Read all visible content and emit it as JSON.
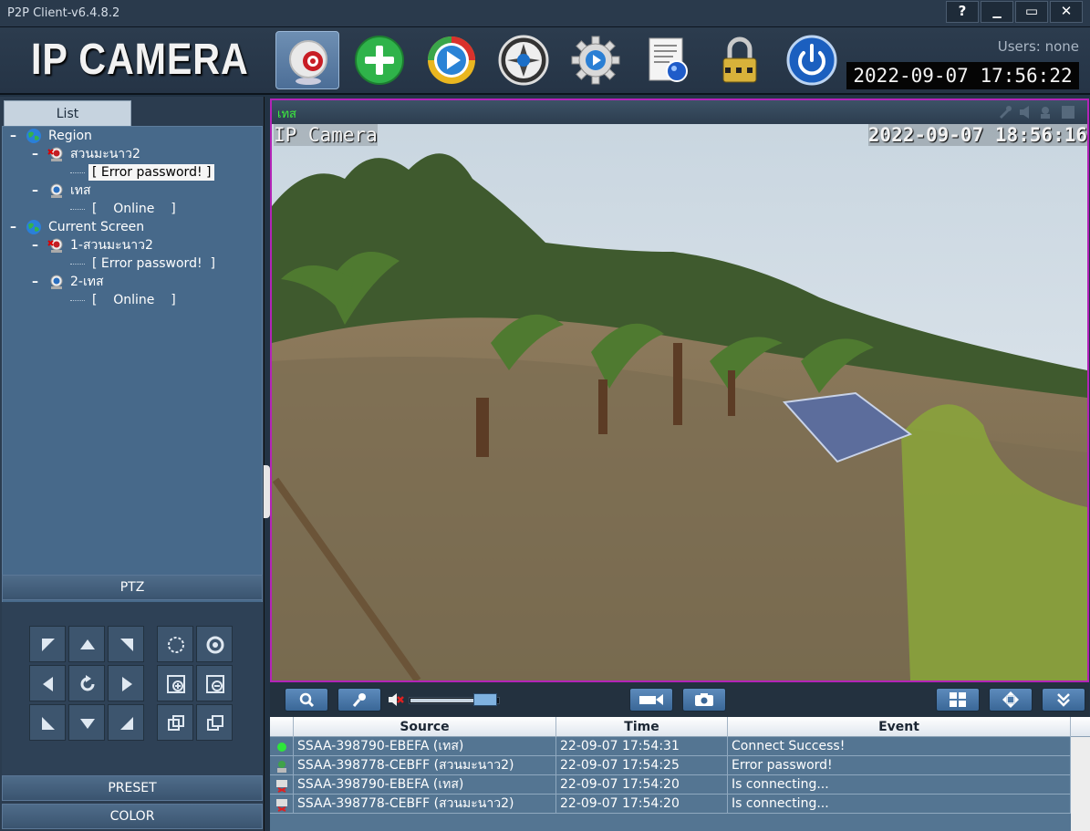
{
  "window": {
    "title": "P2P Client-v6.4.8.2",
    "controls": {
      "help": "?",
      "minimize": "▁",
      "maximize": "▭",
      "close": "✕"
    }
  },
  "header": {
    "logo": "IP CAMERA",
    "users_label": "Users: none",
    "clock": "2022-09-07  17:56:22",
    "toolbar": [
      {
        "name": "live-view",
        "icon": "webcam-icon",
        "active": true
      },
      {
        "name": "add-device",
        "icon": "plus-icon"
      },
      {
        "name": "playback",
        "icon": "play-icon"
      },
      {
        "name": "record",
        "icon": "reel-icon"
      },
      {
        "name": "settings",
        "icon": "gear-icon"
      },
      {
        "name": "log-report",
        "icon": "report-icon"
      },
      {
        "name": "lock",
        "icon": "lock-icon"
      },
      {
        "name": "power",
        "icon": "power-icon"
      }
    ]
  },
  "left": {
    "list_tab": "List",
    "tree": {
      "region": "Region",
      "region_cam1": "สวนมะนาว2",
      "region_cam1_status": "[ Error password! ]",
      "region_cam2": "เทส",
      "region_cam2_status": "[    Online    ]",
      "current": "Current Screen",
      "current_cam1": "1-สวนมะนาว2",
      "current_cam1_status": "[ Error password!  ]",
      "current_cam2": "2-เทส",
      "current_cam2_status": "[    Online    ]"
    },
    "ptz_label": "PTZ",
    "preset_label": "PRESET",
    "color_label": "COLOR"
  },
  "video": {
    "channel_name": "เทส",
    "osd_name": "IP Camera",
    "osd_time": "2022-09-07 18:56:16"
  },
  "tools": {
    "volume_level": 0.75
  },
  "log": {
    "headers": {
      "source": "Source",
      "time": "Time",
      "event": "Event"
    },
    "rows": [
      {
        "status": "success",
        "source": "SSAA-398790-EBEFA (เทส)",
        "time": "22-09-07 17:54:31",
        "event": "Connect Success!"
      },
      {
        "status": "error",
        "source": "SSAA-398778-CEBFF (สวนมะนาว2)",
        "time": "22-09-07 17:54:25",
        "event": "Error password!"
      },
      {
        "status": "connecting",
        "source": "SSAA-398790-EBEFA (เทส)",
        "time": "22-09-07 17:54:20",
        "event": "Is connecting..."
      },
      {
        "status": "connecting",
        "source": "SSAA-398778-CEBFF (สวนมะนาว2)",
        "time": "22-09-07 17:54:20",
        "event": "Is connecting..."
      }
    ]
  }
}
